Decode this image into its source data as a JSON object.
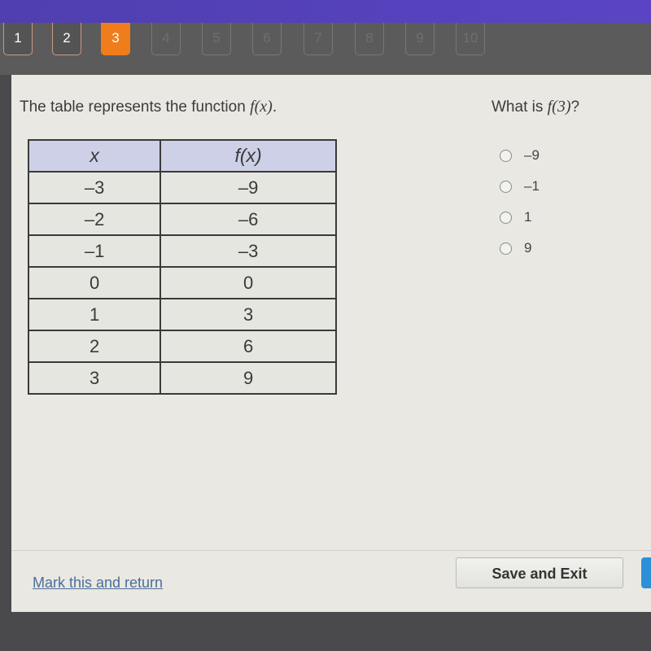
{
  "question_nav": {
    "items": [
      {
        "label": "1",
        "state": "visited"
      },
      {
        "label": "2",
        "state": "visited"
      },
      {
        "label": "3",
        "state": "current"
      },
      {
        "label": "4",
        "state": "unvisited"
      },
      {
        "label": "5",
        "state": "unvisited"
      },
      {
        "label": "6",
        "state": "unvisited"
      },
      {
        "label": "7",
        "state": "unvisited"
      },
      {
        "label": "8",
        "state": "unvisited"
      },
      {
        "label": "9",
        "state": "unvisited"
      },
      {
        "label": "10",
        "state": "unvisited"
      }
    ]
  },
  "prompt": {
    "text": "The table represents the function ",
    "func": "f(x)",
    "end": "."
  },
  "table": {
    "headers": [
      "x",
      "f(x)"
    ],
    "rows": [
      [
        "–3",
        "–9"
      ],
      [
        "–2",
        "–6"
      ],
      [
        "–1",
        "–3"
      ],
      [
        "0",
        "0"
      ],
      [
        "1",
        "3"
      ],
      [
        "2",
        "6"
      ],
      [
        "3",
        "9"
      ]
    ]
  },
  "question": {
    "text": "What is ",
    "func": "f(3)",
    "end": "?",
    "options": [
      "–9",
      "–1",
      "1",
      "9"
    ],
    "selected": null
  },
  "footer": {
    "mark_link": "Mark this and return",
    "save_label": "Save and Exit"
  },
  "colors": {
    "topbar": "#5a44c4",
    "current_question": "#f07d1b",
    "table_header": "#cdd0e6",
    "link": "#4b6f9b",
    "next_button": "#2c90d9"
  }
}
